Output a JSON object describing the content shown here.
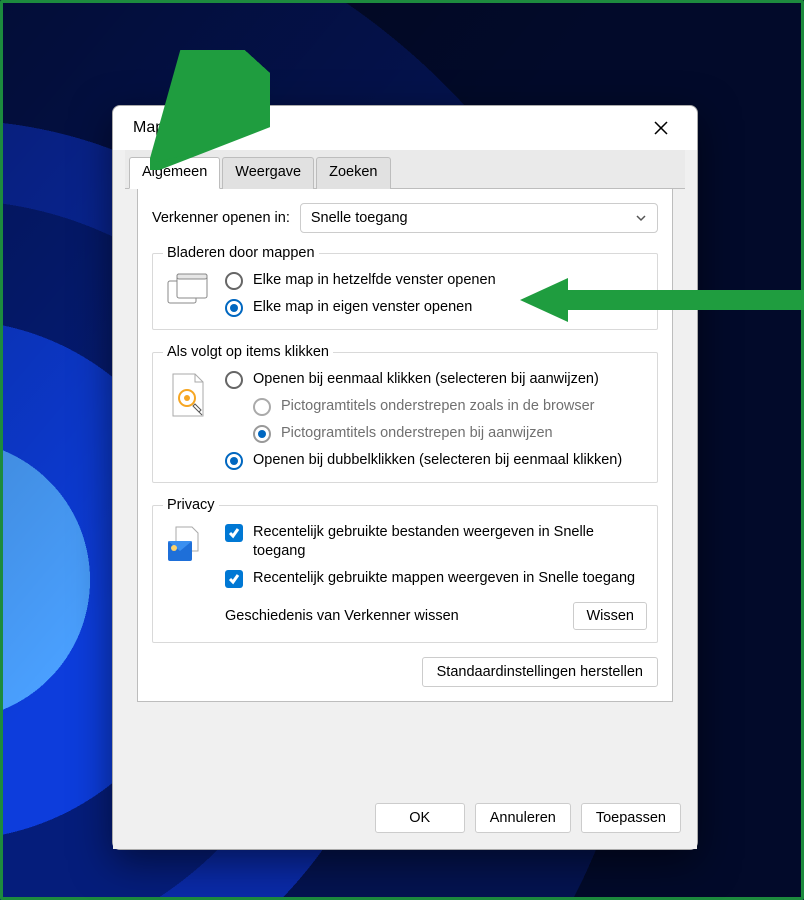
{
  "dialog": {
    "title": "Mapopties"
  },
  "tabs": {
    "general": "Algemeen",
    "view": "Weergave",
    "search": "Zoeken"
  },
  "open_explorer": {
    "label": "Verkenner openen in:",
    "selected": "Snelle toegang"
  },
  "browse": {
    "legend": "Bladeren door mappen",
    "opt_same_window": "Elke map in hetzelfde venster openen",
    "opt_own_window": "Elke map in eigen venster openen"
  },
  "click_items": {
    "legend": "Als volgt op items klikken",
    "single_click": "Openen bij eenmaal klikken (selecteren bij aanwijzen)",
    "underline_browser": "Pictogramtitels onderstrepen zoals in de browser",
    "underline_point": "Pictogramtitels onderstrepen bij aanwijzen",
    "double_click": "Openen bij dubbelklikken (selecteren bij eenmaal klikken)"
  },
  "privacy": {
    "legend": "Privacy",
    "recent_files": "Recentelijk gebruikte bestanden weergeven in Snelle toegang",
    "recent_folders": "Recentelijk gebruikte mappen weergeven in Snelle toegang",
    "history_label": "Geschiedenis van Verkenner wissen",
    "clear_btn": "Wissen"
  },
  "restore_defaults": "Standaardinstellingen herstellen",
  "buttons": {
    "ok": "OK",
    "cancel": "Annuleren",
    "apply": "Toepassen"
  }
}
